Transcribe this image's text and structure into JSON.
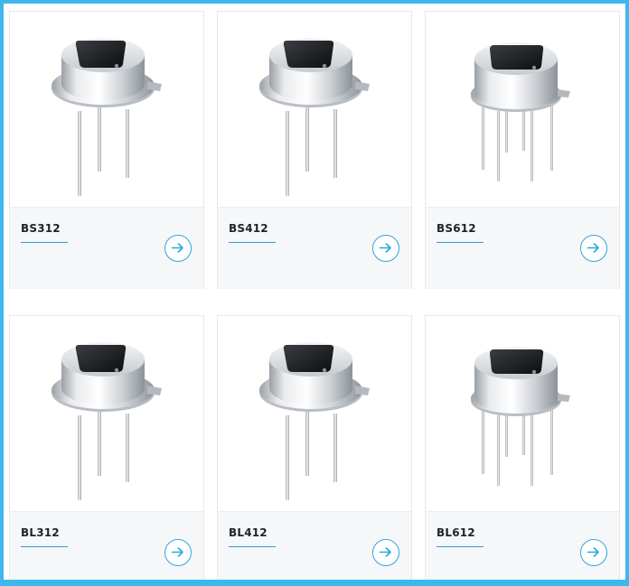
{
  "products": [
    {
      "name": "BS312",
      "icon": "arrow-right-icon",
      "pins": 3
    },
    {
      "name": "BS412",
      "icon": "arrow-right-icon",
      "pins": 3
    },
    {
      "name": "BS612",
      "icon": "arrow-right-icon",
      "pins": 6
    },
    {
      "name": "BL312",
      "icon": "arrow-right-icon",
      "pins": 3
    },
    {
      "name": "BL412",
      "icon": "arrow-right-icon",
      "pins": 3
    },
    {
      "name": "BL612",
      "icon": "arrow-right-icon",
      "pins": 6
    }
  ],
  "colors": {
    "frame_border": "#3db7ec",
    "accent": "#2ea6df",
    "card_footer": "#f6f7f9",
    "title_text": "#1f2329"
  }
}
